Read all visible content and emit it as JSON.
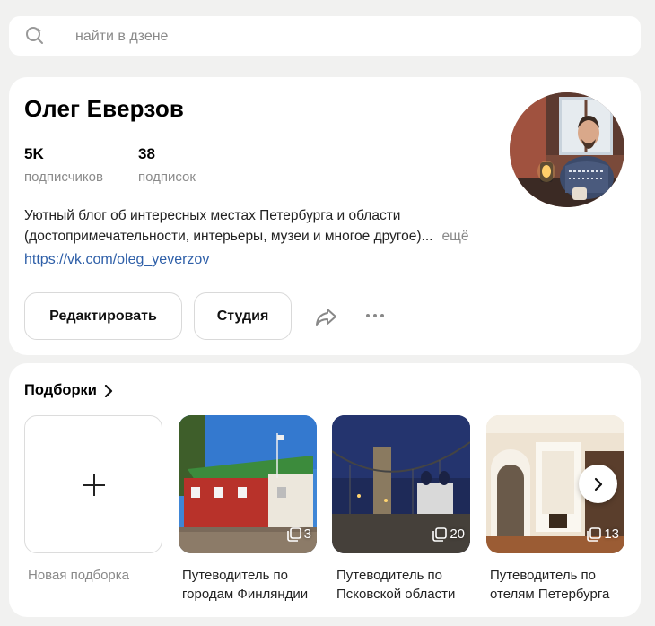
{
  "search": {
    "placeholder": "найти в дзене"
  },
  "profile": {
    "name": "Олег Еверзов",
    "subscribers_value": "5K",
    "subscribers_label": "подписчиков",
    "subscriptions_value": "38",
    "subscriptions_label": "подписок",
    "description_line1": "Уютный блог об интересных местах Петербурга и области",
    "description_line2": "(достопримечательности, интерьеры, музеи и многое другое)...",
    "more_label": "ещё",
    "link": "https://vk.com/oleg_yeverzov",
    "edit_label": "Редактировать",
    "studio_label": "Студия"
  },
  "collections": {
    "title": "Подборки",
    "new_label": "Новая подборка",
    "items": [
      {
        "line1": "Путеводитель по",
        "line2": "городам Финляндии",
        "count": "3"
      },
      {
        "line1": "Путеводитель по",
        "line2": "Псковской области",
        "count": "20"
      },
      {
        "line1": "Путеводитель по",
        "line2": "отелям Петербурга",
        "count": "13"
      }
    ]
  },
  "colors": {
    "link": "#2e5fa8",
    "muted": "#8a8a8a",
    "background": "#f1f1f0"
  }
}
